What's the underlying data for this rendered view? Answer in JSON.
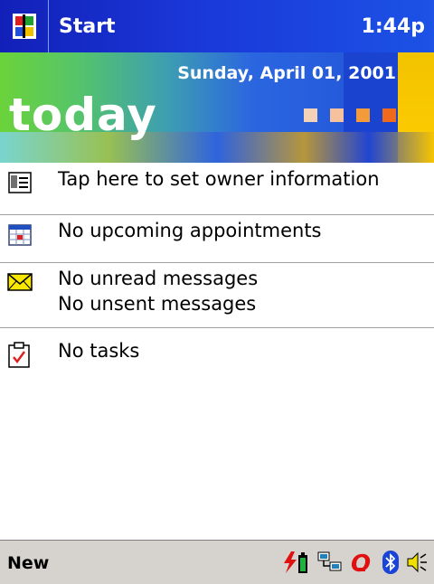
{
  "titlebar": {
    "app_label": "Start",
    "clock": "1:44p",
    "start_icon": "windows-flag-icon"
  },
  "banner": {
    "date": "Sunday, April 01, 2001",
    "title": "today",
    "accent_squares": [
      "#f3d2b8",
      "#f5c29d",
      "#f39a3a",
      "#f06a1d"
    ]
  },
  "items": [
    {
      "icon": "owner-card-icon",
      "lines": [
        "Tap here to set owner information"
      ]
    },
    {
      "icon": "calendar-icon",
      "lines": [
        "No upcoming appointments"
      ]
    },
    {
      "icon": "envelope-icon",
      "lines": [
        "No unread messages",
        "No unsent messages"
      ]
    },
    {
      "icon": "tasks-clipboard-icon",
      "lines": [
        "No tasks"
      ]
    }
  ],
  "bottombar": {
    "new_label": "New",
    "tray_icons": [
      "battery-charging-icon",
      "network-icon",
      "opera-icon",
      "bluetooth-icon",
      "speaker-icon"
    ]
  },
  "colors": {
    "titlebar": "#1a38d8",
    "banner_green": "#6bd33a",
    "banner_blue": "#1f4fd6",
    "banner_yellow": "#ffcc00",
    "bottombar": "#d6d3ce"
  }
}
